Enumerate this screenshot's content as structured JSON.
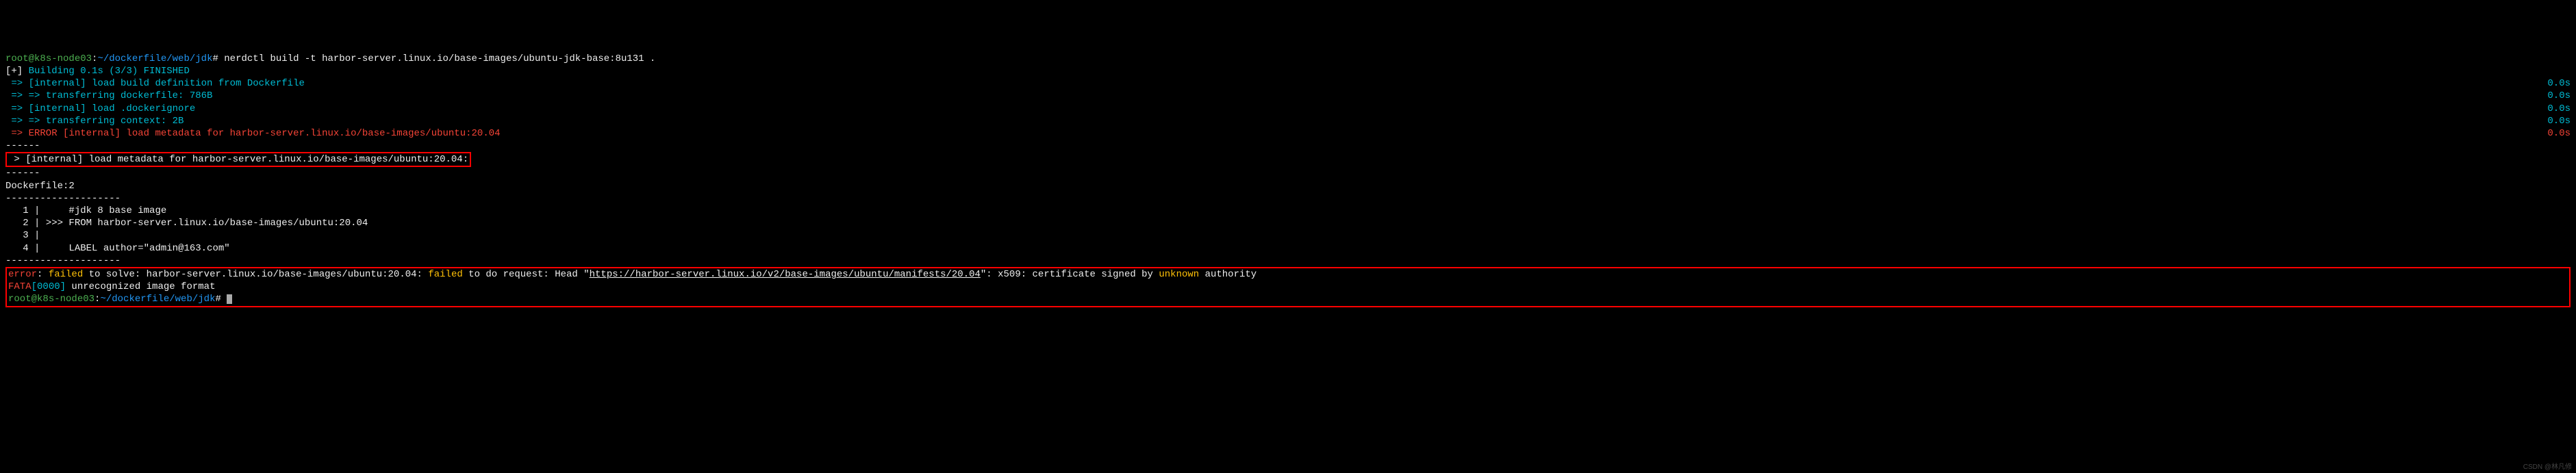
{
  "prompt": {
    "user": "root",
    "host": "k8s-node03",
    "path": "~/dockerfile/web/jdk",
    "symbol": "#"
  },
  "command": "nerdctl build -t harbor-server.linux.io/base-images/ubuntu-jdk-base:8u131 .",
  "build": {
    "status": "[+]",
    "building": "Building 0.1s (3/3) FINISHED",
    "steps": [
      {
        "prefix": " => ",
        "text": "[internal] load build definition from Dockerfile",
        "time": "0.0s",
        "color": "cyan"
      },
      {
        "prefix": " => => ",
        "text": "transferring dockerfile: 786B",
        "time": "0.0s",
        "color": "cyan"
      },
      {
        "prefix": " => ",
        "text": "[internal] load .dockerignore",
        "time": "0.0s",
        "color": "cyan"
      },
      {
        "prefix": " => => ",
        "text": "transferring context: 2B",
        "time": "0.0s",
        "color": "cyan"
      },
      {
        "prefix": " => ERROR ",
        "text": "[internal] load metadata for harbor-server.linux.io/base-images/ubuntu:20.04",
        "time": "0.0s",
        "color": "red"
      }
    ]
  },
  "separator": "------",
  "metadata_line": " > [internal] load metadata for harbor-server.linux.io/base-images/ubuntu:20.04:",
  "dockerfile_label": "Dockerfile:2",
  "dashes": "--------------------",
  "dockerfile_lines": [
    {
      "num": "   1",
      "content": "     #jdk 8 base image"
    },
    {
      "num": "   2",
      "content": " >>> FROM harbor-server.linux.io/base-images/ubuntu:20.04"
    },
    {
      "num": "   3",
      "content": ""
    },
    {
      "num": "   4",
      "content": "     LABEL author=\"admin@163.com\""
    }
  ],
  "error": {
    "label": "error",
    "colon": ": ",
    "failed1": "failed",
    "text1": " to solve: harbor-server.linux.io/base-images/ubuntu:20.04: ",
    "failed2": "failed",
    "text2": " to do request: Head \"",
    "url": "https://harbor-server.linux.io/v2/base-images/ubuntu/manifests/20.04",
    "text3": "\": x509: certificate signed by ",
    "unknown": "unknown",
    "text4": " authority"
  },
  "fata": {
    "label": "FATA",
    "code": "[0000]",
    "text": " unrecognized image format"
  },
  "prompt2": {
    "user": "root",
    "host": "k8s-node03",
    "path": "~/dockerfile/web/jdk",
    "symbol": "#"
  },
  "watermark": "CSDN @林凡修"
}
